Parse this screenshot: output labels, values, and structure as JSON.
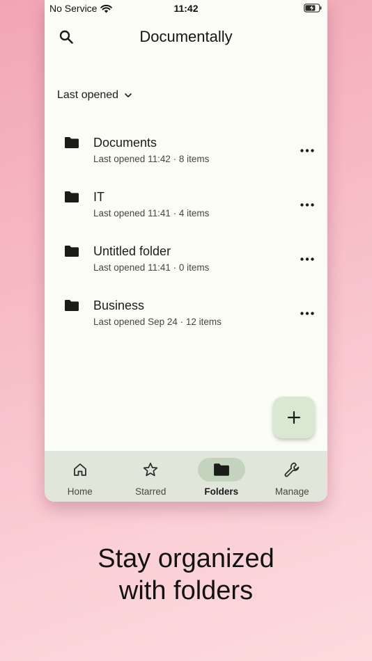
{
  "status_bar": {
    "carrier": "No Service",
    "time": "11:42"
  },
  "app": {
    "title": "Documentally"
  },
  "sort": {
    "label": "Last opened"
  },
  "folders": [
    {
      "name": "Documents",
      "meta": "Last opened 11:42 · 8 items"
    },
    {
      "name": "IT",
      "meta": "Last opened 11:41 · 4 items"
    },
    {
      "name": "Untitled folder",
      "meta": "Last opened 11:41 · 0 items"
    },
    {
      "name": "Business",
      "meta": "Last opened Sep 24 · 12 items"
    }
  ],
  "nav": {
    "home": "Home",
    "starred": "Starred",
    "folders": "Folders",
    "manage": "Manage",
    "active": "folders"
  },
  "caption": {
    "line1": "Stay organized",
    "line2": "with folders"
  },
  "colors": {
    "surface": "#fbfcf6",
    "nav_bg": "#e0e6d9",
    "nav_active_pill": "#c4d3bd",
    "fab_bg": "#d9e8d2",
    "background_gradient_start": "#f2a6b4",
    "background_gradient_end": "#fddadd"
  }
}
